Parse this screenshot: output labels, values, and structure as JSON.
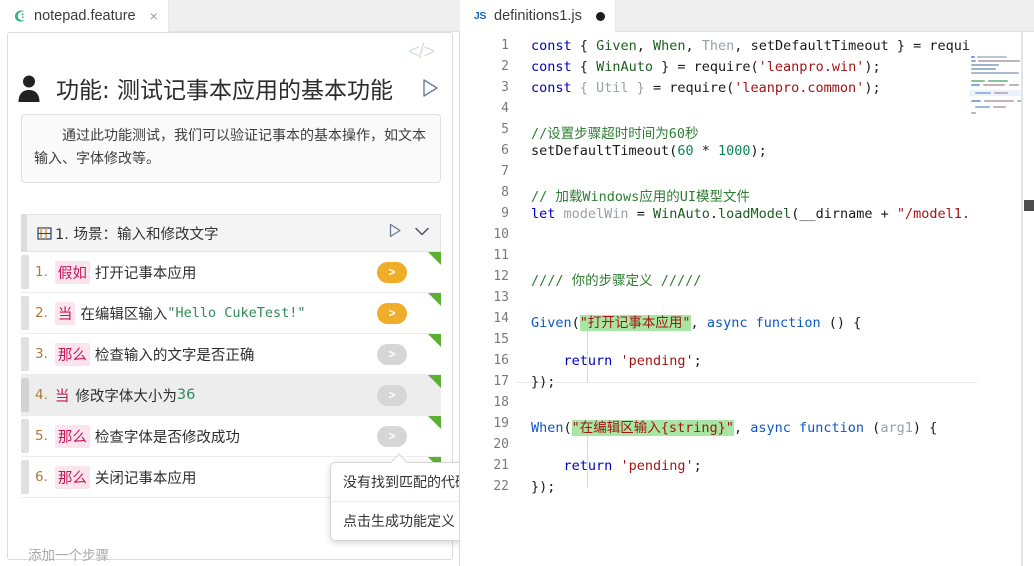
{
  "tabs": {
    "feature": {
      "label": "notepad.feature",
      "icon": "cucumber-icon",
      "close": "×"
    },
    "js": {
      "label": "definitions1.js",
      "badge": "JS",
      "dirty_icon": "unsaved-dot"
    }
  },
  "feature_editor": {
    "code_toggle_icon": "</>",
    "title": "功能: 测试记事本应用的基本功能",
    "description": "通过此功能测试，我们可以验证记事本的基本操作，如文本输入、字体修改等。",
    "scenario": {
      "label": "1. 场景：输入和修改文字",
      "play_icon": "play-icon",
      "collapse_icon": "chevron-down-icon"
    },
    "steps": [
      {
        "num": "1.",
        "keyword": "假如",
        "text": "打开记事本应用",
        "literal": "",
        "literal_type": "",
        "state": "ready",
        "selected": false
      },
      {
        "num": "2.",
        "keyword": "当",
        "text": "在编辑区输入",
        "literal": "\"Hello CukeTest!\"",
        "literal_type": "string",
        "state": "ready",
        "selected": false
      },
      {
        "num": "3.",
        "keyword": "那么",
        "text": "检查输入的文字是否正确",
        "literal": "",
        "literal_type": "",
        "state": "muted",
        "selected": false
      },
      {
        "num": "4.",
        "keyword": "当",
        "text": "修改字体大小为",
        "literal": "36",
        "literal_type": "number",
        "state": "muted",
        "selected": true
      },
      {
        "num": "5.",
        "keyword": "那么",
        "text": "检查字体是否修改成功",
        "literal": "",
        "literal_type": "",
        "state": "muted",
        "selected": false
      },
      {
        "num": "6.",
        "keyword": "那么",
        "text": "关闭记事本应用",
        "literal": "",
        "literal_type": "",
        "state": "muted",
        "selected": false
      }
    ],
    "add_step_label": "添加一个步骤",
    "run_button_glyph": ">"
  },
  "tooltip": {
    "line1": "没有找到匹配的代码",
    "line2": "点击生成功能定义"
  },
  "code_editor": {
    "line_numbers": [
      "1",
      "2",
      "3",
      "4",
      "5",
      "6",
      "7",
      "8",
      "9",
      "10",
      "11",
      "12",
      "13",
      "14",
      "15",
      "16",
      "17",
      "18",
      "19",
      "20",
      "21",
      "22"
    ],
    "lines": [
      "const { Given, When, Then, setDefaultTimeout } = requi",
      "const { WinAuto } = require('leanpro.win');",
      "const { Util } = require('leanpro.common');",
      "",
      "//设置步骤超时时间为60秒",
      "setDefaultTimeout(60 * 1000);",
      "",
      "// 加载Windows应用的UI模型文件",
      "let modelWin = WinAuto.loadModel(__dirname + \"/model1.",
      "",
      "",
      "//// 你的步骤定义 /////",
      "",
      "Given(\"打开记事本应用\", async function () {",
      "",
      "    return 'pending';",
      "});",
      "",
      "When(\"在编辑区输入{string}\", async function (arg1) {",
      "",
      "    return 'pending';",
      "});"
    ],
    "highlighted_strings": [
      "\"打开记事本应用\"",
      "\"在编辑区输入{string}\""
    ]
  },
  "colors": {
    "accent_orange": "#f0ad29",
    "keyword_pink": "#c2185b",
    "keyword_bg": "#fce4ec",
    "green_corner": "#5bb033",
    "find_highlight": "#a8e6a3",
    "code_keyword_blue": "#0000c0",
    "code_string_red": "#a31515",
    "code_comment_green": "#2e7d32"
  }
}
